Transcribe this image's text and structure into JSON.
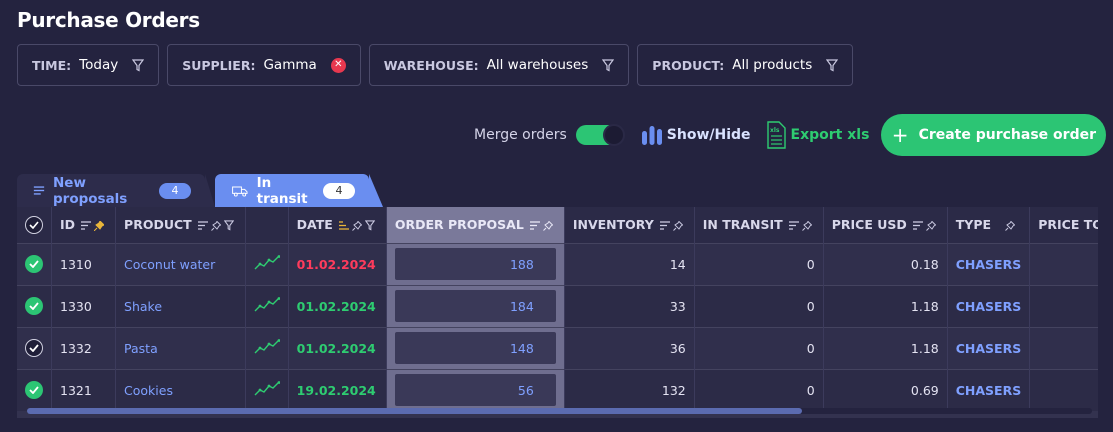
{
  "page": {
    "title": "Purchase Orders"
  },
  "filters": [
    {
      "label": "TIME:",
      "value": "Today",
      "icon": "filter-icon"
    },
    {
      "label": "SUPPLIER:",
      "value": "Gamma",
      "icon": "clear-icon"
    },
    {
      "label": "WAREHOUSE:",
      "value": "All warehouses",
      "icon": "filter-icon"
    },
    {
      "label": "PRODUCT:",
      "value": "All products",
      "icon": "filter-icon"
    }
  ],
  "toolbar": {
    "merge_label": "Merge orders",
    "merge_on": true,
    "showhide_label": "Show/Hide",
    "export_label": "Export xls",
    "create_label": "Create purchase order",
    "create_icon": "+"
  },
  "tabs": [
    {
      "label": "New proposals",
      "count": "4",
      "icon": "list-icon",
      "active": false
    },
    {
      "label": "In transit",
      "count": "4",
      "icon": "truck-icon",
      "active": true
    }
  ],
  "table": {
    "columns": {
      "id": "ID",
      "product": "PRODUCT",
      "date": "DATE",
      "order_proposal": "ORDER PROPOSAL",
      "inventory": "INVENTORY",
      "in_transit": "IN TRANSIT",
      "price_usd": "PRICE USD",
      "type": "TYPE",
      "price_total": "PRICE TOTAL"
    },
    "rows": [
      {
        "checked": true,
        "id": "1310",
        "product": "Coconut water",
        "date": "01.02.2024",
        "date_status": "overdue",
        "order_proposal": "188",
        "inventory": "14",
        "in_transit": "0",
        "price_usd": "0.18",
        "type": "CHASERS"
      },
      {
        "checked": true,
        "id": "1330",
        "product": "Shake",
        "date": "01.02.2024",
        "date_status": "ok",
        "order_proposal": "184",
        "inventory": "33",
        "in_transit": "0",
        "price_usd": "1.18",
        "type": "CHASERS"
      },
      {
        "checked": false,
        "id": "1332",
        "product": "Pasta",
        "date": "01.02.2024",
        "date_status": "ok",
        "order_proposal": "148",
        "inventory": "36",
        "in_transit": "0",
        "price_usd": "1.18",
        "type": "CHASERS"
      },
      {
        "checked": true,
        "id": "1321",
        "product": "Cookies",
        "date": "19.02.2024",
        "date_status": "ok",
        "order_proposal": "56",
        "inventory": "132",
        "in_transit": "0",
        "price_usd": "0.69",
        "type": "CHASERS"
      }
    ]
  },
  "colors": {
    "background": "#24233f",
    "accent_green": "#2cc574",
    "accent_blue": "#6a8ef0",
    "link_blue": "#7fa0ff",
    "date_red": "#ff3b5c",
    "date_green": "#2ecc71"
  }
}
